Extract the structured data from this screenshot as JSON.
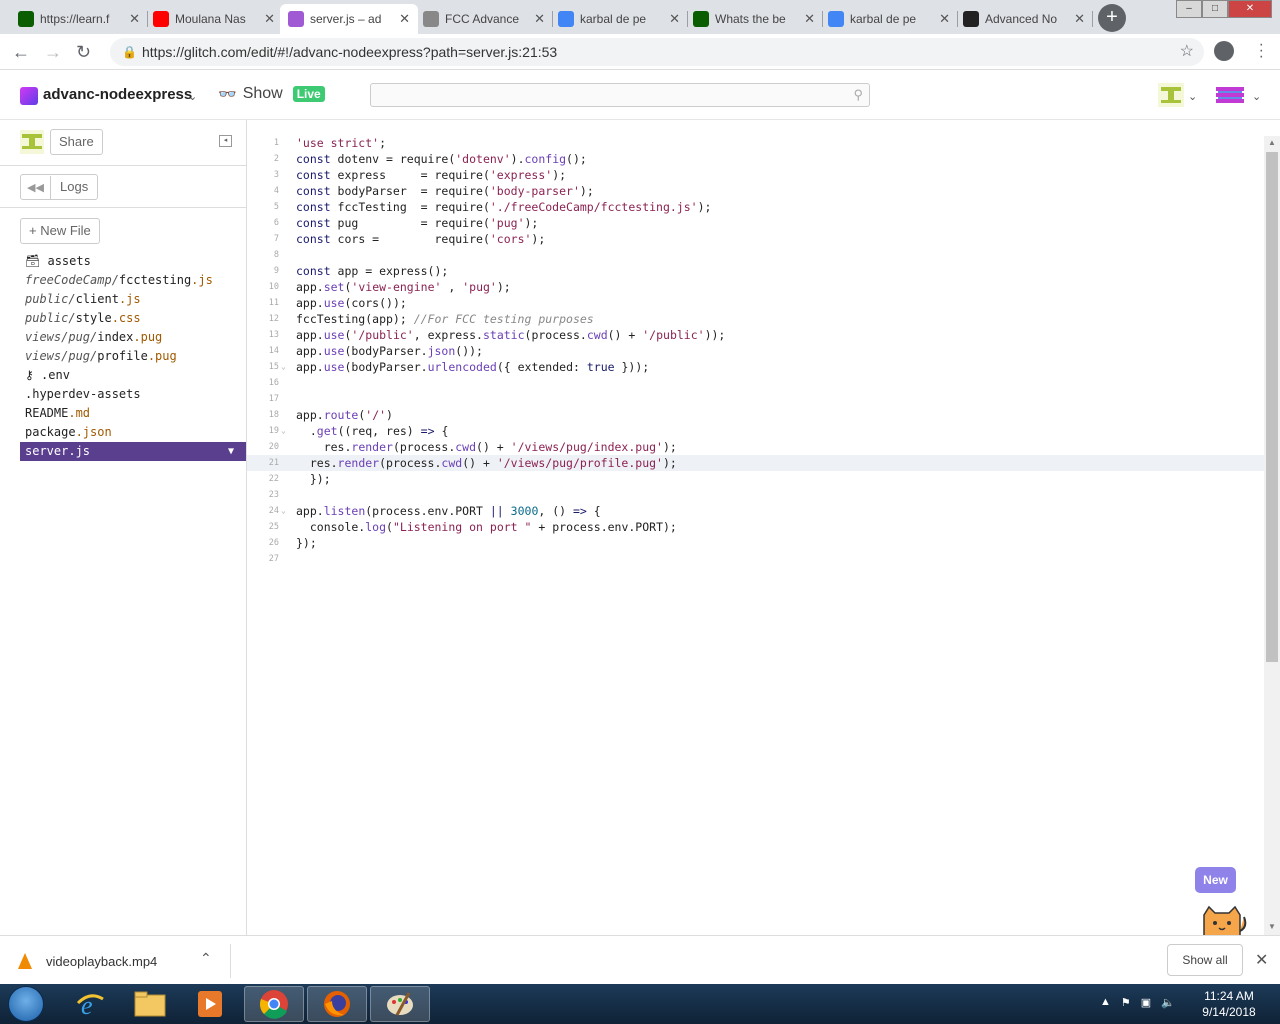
{
  "browser": {
    "tabs": [
      {
        "title": "https://learn.f",
        "favicon": "fcc-icon",
        "color": "#0a5d00"
      },
      {
        "title": "Moulana Nas",
        "favicon": "youtube-icon",
        "color": "#ff0000"
      },
      {
        "title": "server.js – ad",
        "favicon": "glitch-icon",
        "color": "#a05bd4",
        "active": true
      },
      {
        "title": "FCC Advance",
        "favicon": "document-icon",
        "color": "#888888"
      },
      {
        "title": "karbal de pe",
        "favicon": "google-icon",
        "color": "#4285f4"
      },
      {
        "title": "Whats the be",
        "favicon": "fcc-icon",
        "color": "#0a5d00"
      },
      {
        "title": "karbal de pe",
        "favicon": "google-icon",
        "color": "#4285f4"
      },
      {
        "title": "Advanced No",
        "favicon": "github-icon",
        "color": "#222222"
      }
    ],
    "url": "https://glitch.com/edit/#!/advanc-nodeexpress?path=server.js:21:53"
  },
  "glitch": {
    "project_name": "advanc-nodeexpress",
    "show_label": "Show",
    "live_label": "Live",
    "search_placeholder": "",
    "share_label": "Share",
    "logs_label": "Logs",
    "new_file_label": "+ New File",
    "files": [
      {
        "kind": "assets",
        "name": "assets"
      },
      {
        "dir": "freeCodeCamp/",
        "base": "fcctesting",
        "ext": ".js"
      },
      {
        "dir": "public/",
        "base": "client",
        "ext": ".js"
      },
      {
        "dir": "public/",
        "base": "style",
        "ext": ".css"
      },
      {
        "dir": "views/pug/",
        "base": "index",
        "ext": ".pug"
      },
      {
        "dir": "views/pug/",
        "base": "profile",
        "ext": ".pug"
      },
      {
        "kind": "env",
        "name": ".env"
      },
      {
        "dir": "",
        "base": ".hyperdev-assets",
        "ext": ""
      },
      {
        "dir": "",
        "base": "README",
        "ext": ".md"
      },
      {
        "dir": "",
        "base": "package",
        "ext": ".json"
      },
      {
        "dir": "",
        "base": "server",
        "ext": ".js",
        "active": true
      }
    ],
    "new_badge": "New",
    "current_line": 21
  },
  "code_lines": [
    "'use strict';",
    "const dotenv = require('dotenv').config();",
    "const express     = require('express');",
    "const bodyParser  = require('body-parser');",
    "const fccTesting  = require('./freeCodeCamp/fcctesting.js');",
    "const pug         = require('pug');",
    "const cors =        require('cors');",
    "",
    "const app = express();",
    "app.set('view-engine' , 'pug');",
    "app.use(cors());",
    "fccTesting(app); //For FCC testing purposes",
    "app.use('/public', express.static(process.cwd() + '/public'));",
    "app.use(bodyParser.json());",
    "app.use(bodyParser.urlencoded({ extended: true }));",
    "",
    "",
    "app.route('/')",
    "  .get((req, res) => {",
    "    res.render(process.cwd() + '/views/pug/index.pug');",
    "  res.render(process.cwd() + '/views/pug/profile.pug');",
    "  });",
    "",
    "app.listen(process.env.PORT || 3000, () => {",
    "  console.log(\"Listening on port \" + process.env.PORT);",
    "});",
    ""
  ],
  "fold_lines": [
    15,
    19,
    24
  ],
  "download": {
    "file": "videoplayback.mp4",
    "show_all": "Show all"
  },
  "taskbar": {
    "time": "11:24 AM",
    "date": "9/14/2018"
  }
}
